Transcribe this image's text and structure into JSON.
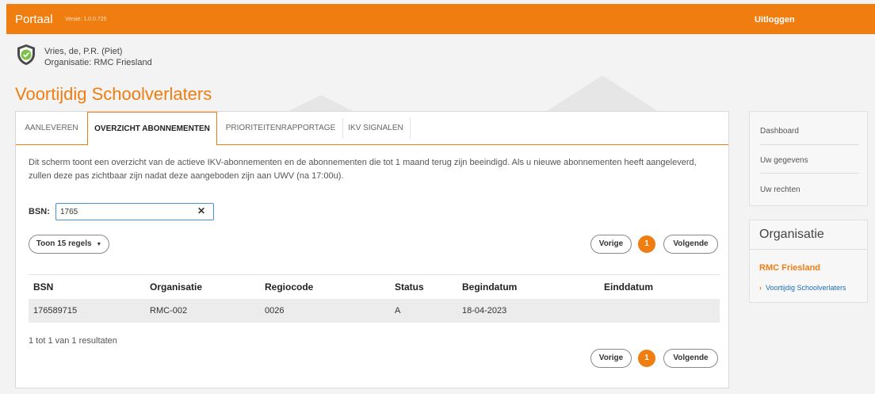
{
  "header": {
    "brand": "Portaal",
    "version": "Versie: 1.0.0.725",
    "logout": "Uitloggen"
  },
  "user": {
    "name": "Vries, de, P.R. (Piet)",
    "organisation": "Organisatie: RMC Friesland"
  },
  "page": {
    "title": "Voortijdig Schoolverlaters"
  },
  "tabs": [
    {
      "label": "AANLEVEREN"
    },
    {
      "label": "OVERZICHT ABONNEMENTEN"
    },
    {
      "label": "PRIORITEITENRAPPORTAGE"
    },
    {
      "label": "IKV SIGNALEN"
    }
  ],
  "content": {
    "description": "Dit scherm toont een overzicht van de actieve IKV-abonnementen en de abonnementen die tot 1 maand terug zijn beeindigd. Als u nieuwe abonnementen heeft aangeleverd, zullen deze pas zichtbaar zijn nadat deze aangeboden zijn aan UWV (na 17:00u).",
    "bsn_label": "BSN:",
    "bsn_value": "1765",
    "show_rows": "Toon 15 regels",
    "prev": "Vorige",
    "next": "Volgende",
    "page": "1",
    "result_text": "1 tot 1 van 1 resultaten"
  },
  "table": {
    "headers": [
      "BSN",
      "Organisatie",
      "Regiocode",
      "Status",
      "Begindatum",
      "Einddatum"
    ],
    "rows": [
      [
        "176589715",
        "RMC-002",
        "0026",
        "A",
        "18-04-2023",
        ""
      ]
    ]
  },
  "sidebar": {
    "menu": [
      {
        "label": "Dashboard"
      },
      {
        "label": "Uw gegevens"
      },
      {
        "label": "Uw rechten"
      }
    ],
    "org_title": "Organisatie",
    "org_name": "RMC Friesland",
    "org_link": "Voortijdig Schoolverlaters"
  },
  "colors": {
    "brand": "#ef7d10",
    "link": "#1a6fb5"
  },
  "icons": {
    "logo": "shield-check-icon",
    "clear": "close-icon",
    "dropdown": "caret-down-icon",
    "link": "chevron-right-icon"
  }
}
